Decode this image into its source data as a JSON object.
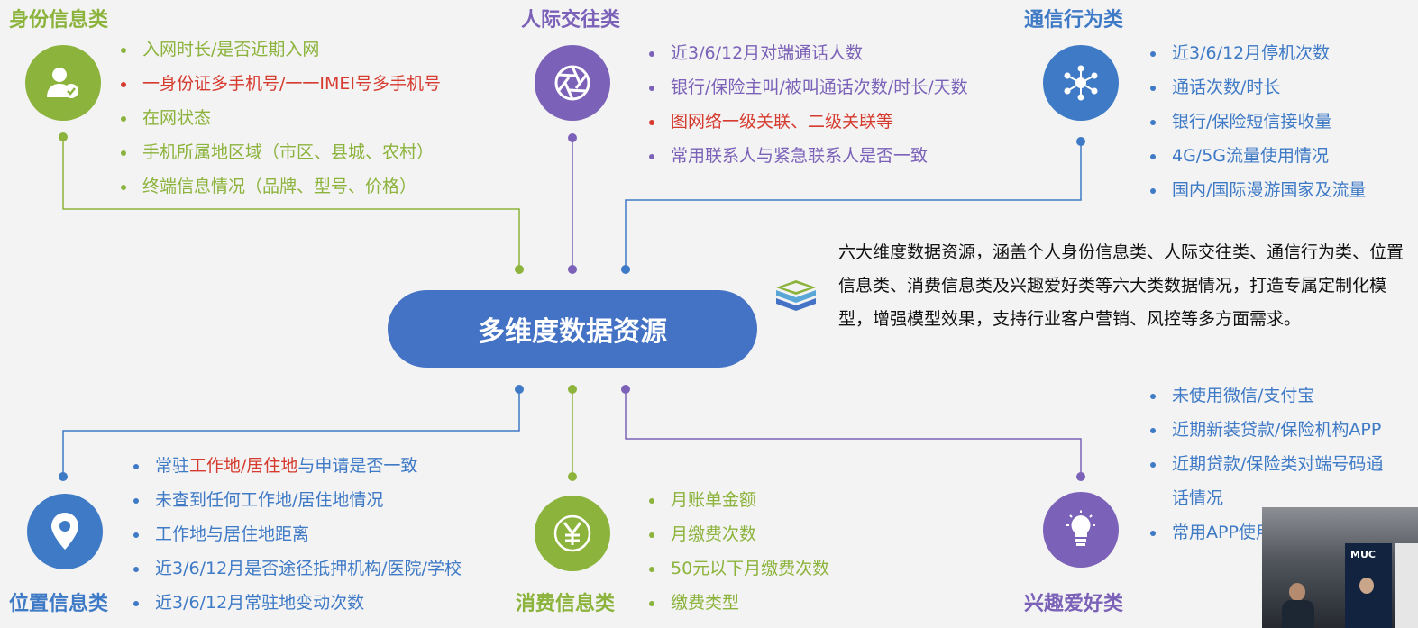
{
  "center": {
    "label": "多维度数据资源"
  },
  "description": "六大维度数据资源，涵盖个人身份信息类、人际交往类、通信行为类、位置信息类、消费信息类及兴趣爱好类等六大类数据情况，打造专属定制化模型，增强模型效果，支持行业客户营销、风控等多方面需求。",
  "categories": {
    "identity": {
      "title": "身份信息类",
      "color": "#8cb33c",
      "icon": "user-check-icon",
      "items": [
        "入网时长/是否近期入网",
        "一身份证多手机号/一一IMEI号多手机号",
        "在网状态",
        "手机所属地区域（市区、县城、农村）",
        "终端信息情况（品牌、型号、价格）"
      ]
    },
    "social": {
      "title": "人际交往类",
      "color": "#7b62b8",
      "icon": "aperture-icon",
      "items": [
        "近3/6/12月对端通话人数",
        "银行/保险主叫/被叫通话次数/时长/天数",
        "图网络一级关联、二级关联等",
        "常用联系人与紧急联系人是否一致"
      ]
    },
    "communication": {
      "title": "通信行为类",
      "color": "#3f7ac6",
      "icon": "network-icon",
      "items": [
        "近3/6/12月停机次数",
        "通话次数/时长",
        "银行/保险短信接收量",
        "4G/5G流量使用情况",
        "国内/国际漫游国家及流量"
      ]
    },
    "location": {
      "title": "位置信息类",
      "color": "#3f7ac6",
      "icon": "map-pin-icon",
      "items": [
        "未查到任何工作地/居住地情况",
        "工作地与居住地距离",
        "近3/6/12月是否途径抵押机构/医院/学校",
        "近3/6/12月常驻地变动次数"
      ],
      "first_item_parts": [
        "常驻",
        "工作地/居住地",
        "与申请是否一致"
      ]
    },
    "consumption": {
      "title": "消费信息类",
      "color": "#8cb33c",
      "icon": "yen-icon",
      "items": [
        "月账单金额",
        "月缴费次数",
        "50元以下月缴费次数",
        "缴费类型"
      ]
    },
    "interest": {
      "title": "兴趣爱好类",
      "color": "#7b62b8",
      "icon": "lightbulb-icon",
      "items": [
        "未使用微信/支付宝",
        "近期新装贷款/保险机构APP",
        "近期贷款/保险类对端号码通话情况",
        "常用APP使用时长"
      ]
    }
  },
  "video_overlay": {
    "badge": "MUC"
  }
}
